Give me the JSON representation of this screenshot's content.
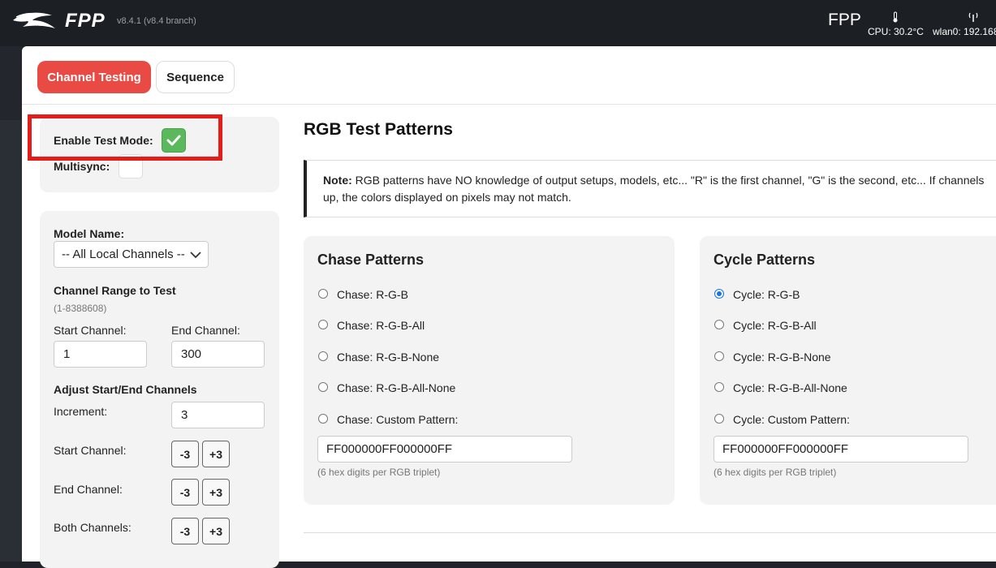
{
  "header": {
    "brand": "FPP",
    "version": "v8.4.1 (v8.4 branch)",
    "host": "FPP",
    "cpu": "CPU: 30.2°C",
    "wlan": "wlan0: 192.168"
  },
  "tabs": [
    {
      "label": "Channel Testing",
      "active": true
    },
    {
      "label": "Sequence",
      "active": false
    }
  ],
  "test_mode": {
    "enable_label": "Enable Test Mode:",
    "enable_checked": true,
    "multisync_label": "Multisync:",
    "multisync_checked": false
  },
  "channel": {
    "model_label": "Model Name:",
    "model_value": "-- All Local Channels --",
    "range_title": "Channel Range to Test",
    "range_hint": "(1-8388608)",
    "start_label": "Start Channel:",
    "start_value": "1",
    "end_label": "End Channel:",
    "end_value": "300",
    "adjust_title": "Adjust Start/End Channels",
    "increment_label": "Increment:",
    "increment_value": "3",
    "adj_start_label": "Start Channel:",
    "adj_end_label": "End Channel:",
    "adj_both_label": "Both Channels:",
    "minus_label": "-3",
    "plus_label": "+3"
  },
  "rgb": {
    "title": "RGB Test Patterns",
    "note_bold": "Note:",
    "note_line1": " RGB patterns have NO knowledge of output setups, models, etc... \"R\" is the first channel, \"G\" is the second, etc... If channels",
    "note_line2": "up, the colors displayed on pixels may not match."
  },
  "chase": {
    "title": "Chase Patterns",
    "options": [
      "Chase: R-G-B",
      "Chase: R-G-B-All",
      "Chase: R-G-B-None",
      "Chase: R-G-B-All-None",
      "Chase: Custom Pattern:"
    ],
    "custom_value": "FF000000FF000000FF",
    "hint": "(6 hex digits per RGB triplet)"
  },
  "cycle": {
    "title": "Cycle Patterns",
    "options": [
      "Cycle: R-G-B",
      "Cycle: R-G-B-All",
      "Cycle: R-G-B-None",
      "Cycle: R-G-B-All-None",
      "Cycle: Custom Pattern:"
    ],
    "selected_index": 0,
    "custom_value": "FF000000FF000000FF",
    "hint": "(6 hex digits per RGB triplet)"
  },
  "colors": {
    "accent": "#e94a43",
    "check_green": "#5cb85c",
    "highlight_red": "#e31d1a",
    "radio_blue": "#1a73e8"
  },
  "icons": {
    "logo": "fpp-logo-icon",
    "temperature": "thermometer-icon",
    "wifi": "antenna-icon",
    "checkmark": "check-icon",
    "dropdown": "chevron-down-icon"
  }
}
